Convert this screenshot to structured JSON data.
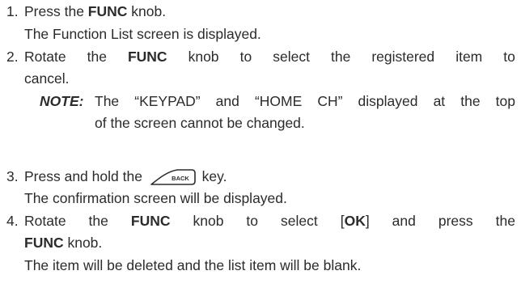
{
  "steps": [
    {
      "number": "1.",
      "pre": "Press the ",
      "bold": "FUNC",
      "post": " knob.",
      "result": "The Function List screen is displayed."
    },
    {
      "number": "2.",
      "line1_a": "Rotate",
      "line1_b": "the",
      "line1_c": "FUNC",
      "line1_d": "knob",
      "line1_e": "to",
      "line1_f": "select",
      "line1_g": "the",
      "line1_h": "registered",
      "line1_i": "item",
      "line1_j": "to",
      "line2": "cancel."
    },
    {
      "number": "3.",
      "pre": "Press and hold the ",
      "key_label": "BACK",
      "post": " key.",
      "result": "The confirmation screen will be displayed."
    },
    {
      "number": "4.",
      "line1_pre": "Rotate the ",
      "line1_bold": "FUNC",
      "line1_mid": " knob to select [",
      "line1_ok": "OK",
      "line1_post": "] and press the",
      "line2_bold": "FUNC",
      "line2_post": " knob.",
      "result": "The item will be deleted and the list item will be blank."
    }
  ],
  "note": {
    "label": "NOTE:",
    "line1": "The “KEYPAD” and “HOME CH” displayed at the top",
    "line2": "of the screen cannot be changed."
  }
}
